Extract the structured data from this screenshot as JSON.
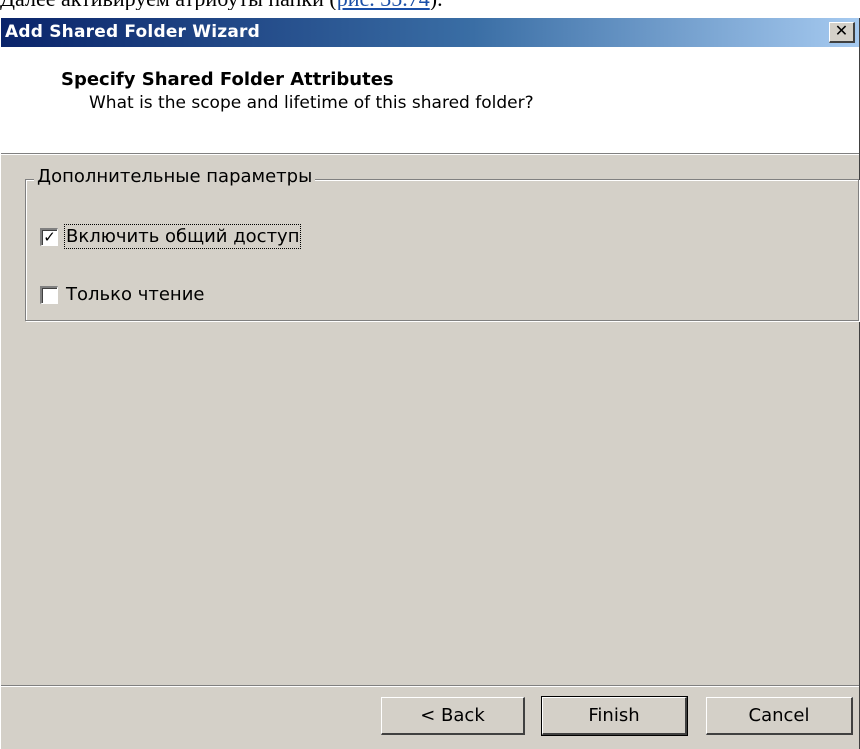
{
  "doc_line": {
    "text": "Далее активируем атрибуты папки (",
    "link": "рис. 35.74",
    "tail": ")."
  },
  "window": {
    "title": "Add Shared Folder Wizard",
    "close_glyph": "✕"
  },
  "header": {
    "title": "Specify Shared Folder Attributes",
    "subtitle": "What is the scope and lifetime of this shared folder?"
  },
  "options_group": {
    "legend": "Дополнительные параметры",
    "items": [
      {
        "label": "Включить общий доступ",
        "checked": true
      },
      {
        "label": "Только чтение",
        "checked": false
      }
    ]
  },
  "buttons": {
    "back": "< Back",
    "finish": "Finish",
    "cancel": "Cancel"
  },
  "icons": {
    "check": "✓"
  }
}
